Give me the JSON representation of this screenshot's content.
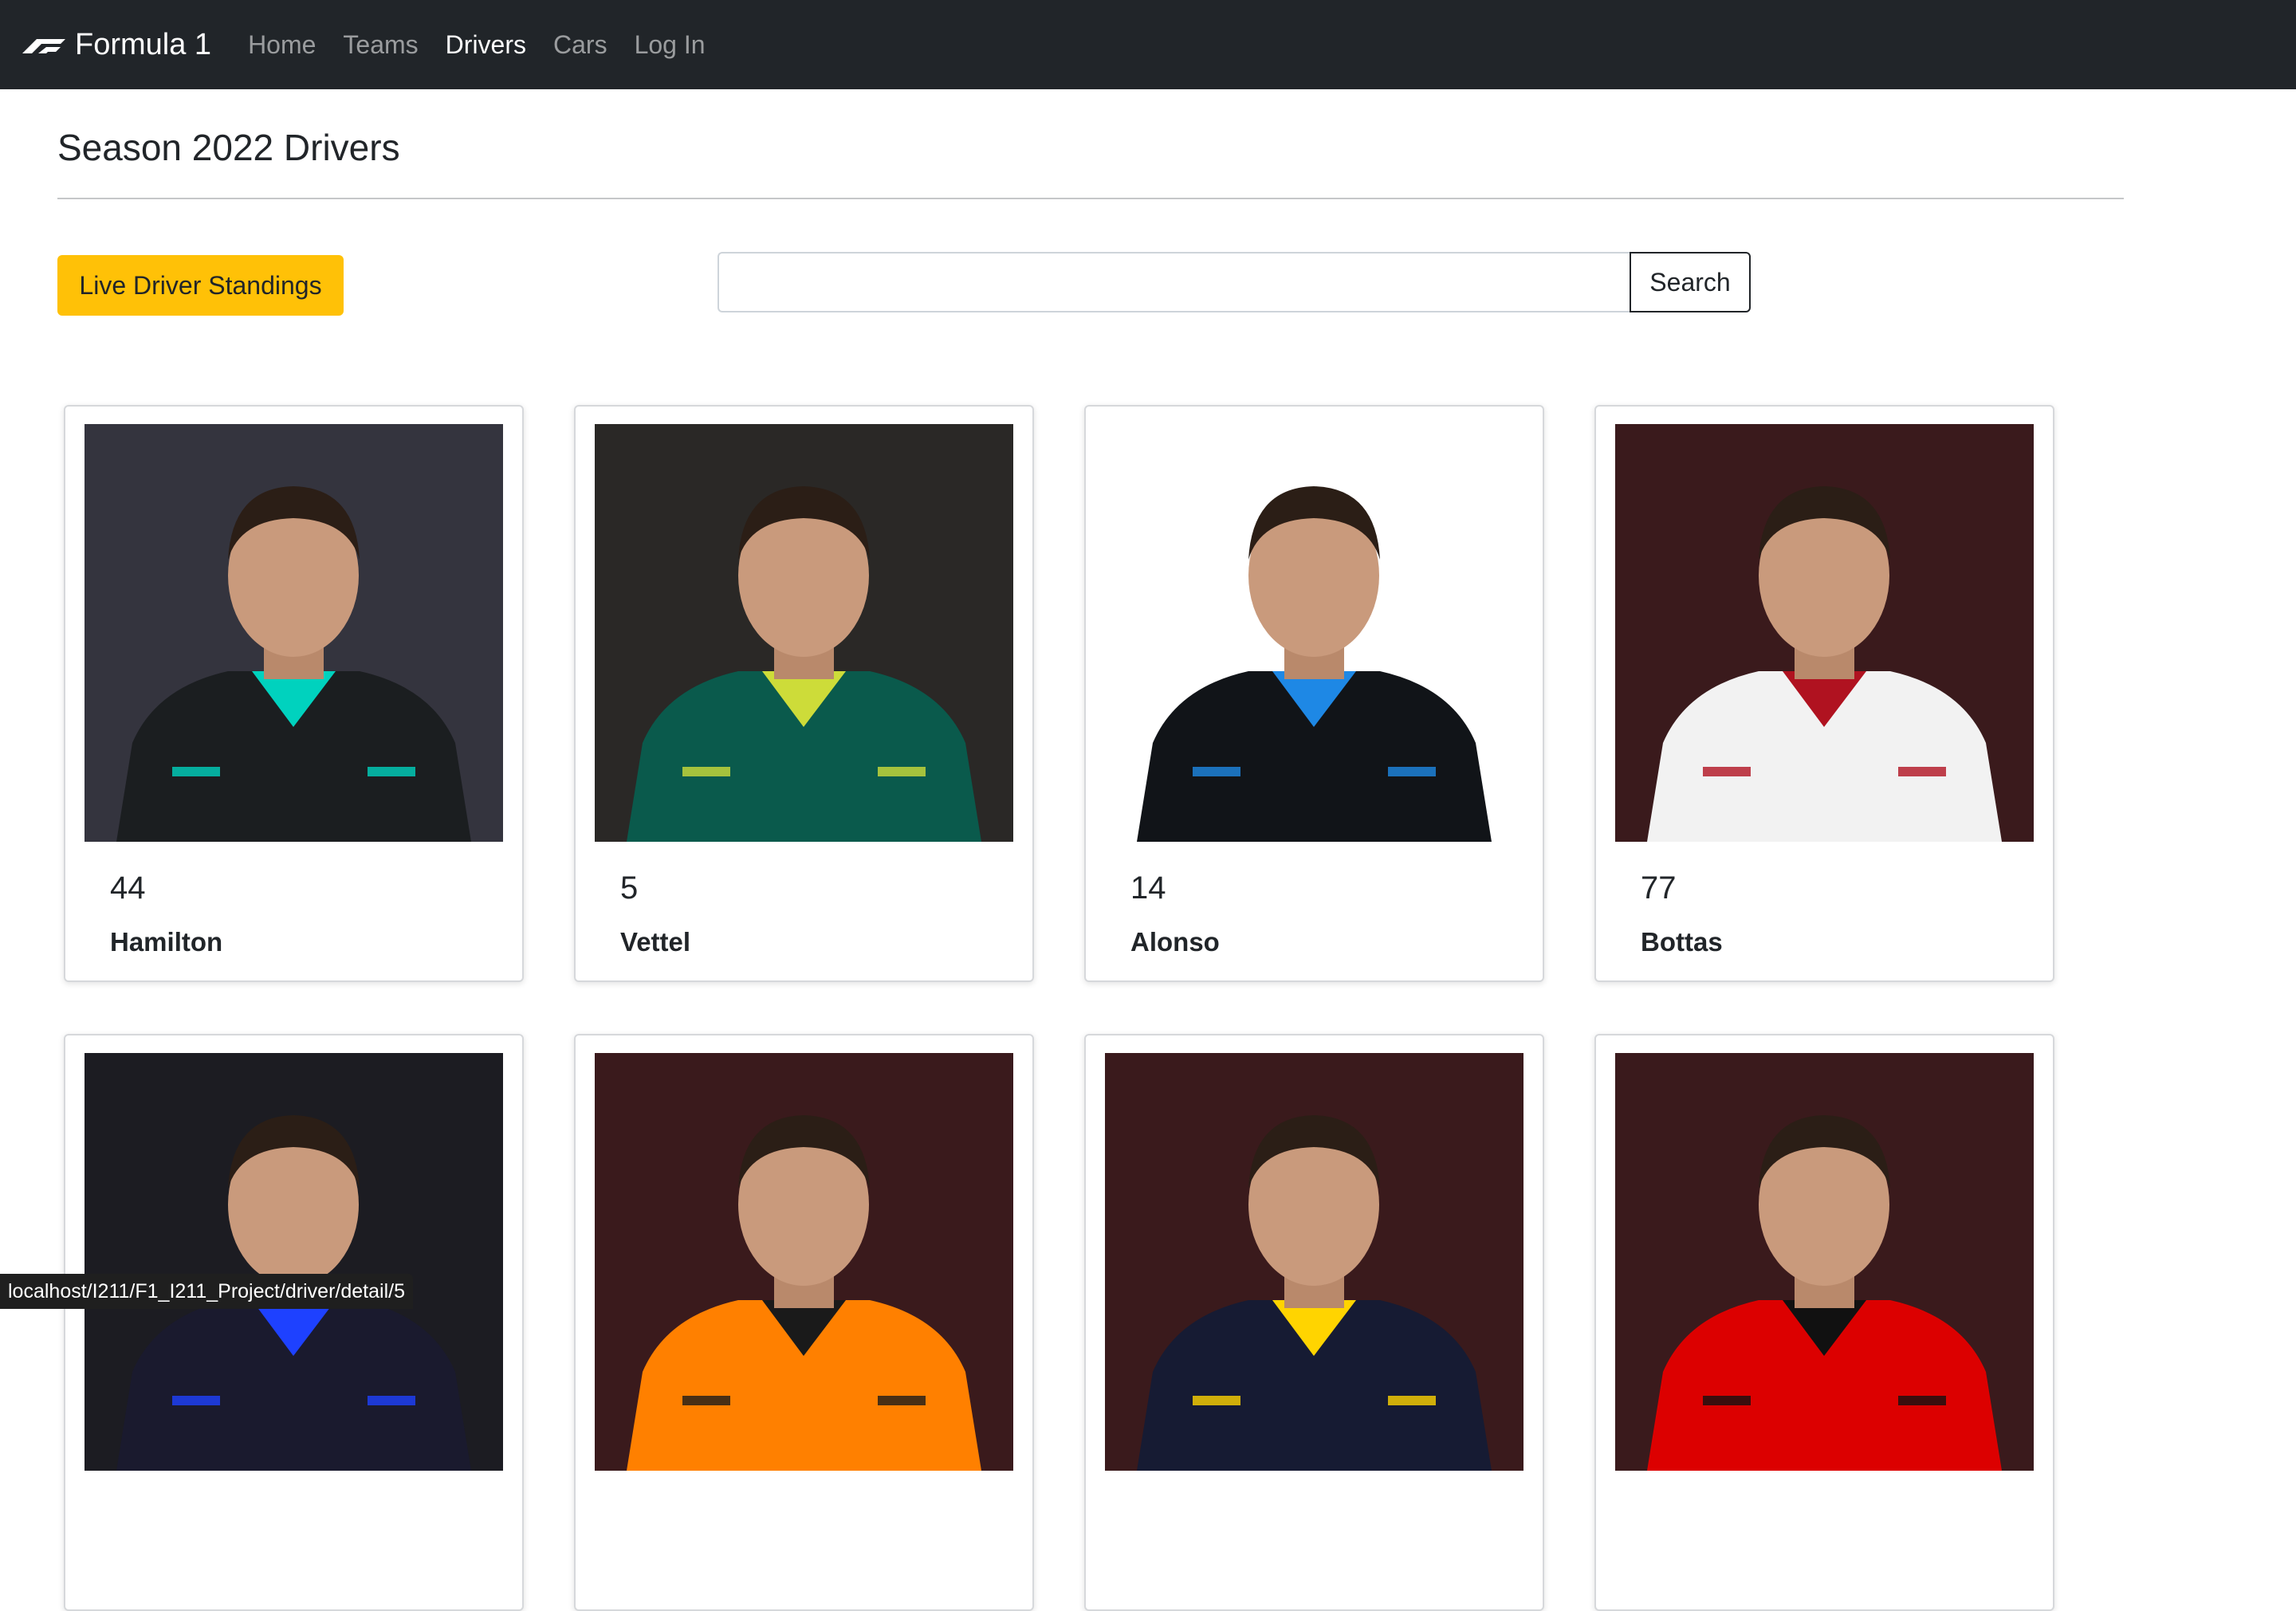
{
  "navbar": {
    "brand": "Formula 1",
    "links": [
      {
        "label": "Home",
        "active": false
      },
      {
        "label": "Teams",
        "active": false
      },
      {
        "label": "Drivers",
        "active": true
      },
      {
        "label": "Cars",
        "active": false
      },
      {
        "label": "Log In",
        "active": false
      }
    ]
  },
  "page": {
    "title": "Season 2022 Drivers"
  },
  "actions": {
    "standings_label": "Live Driver Standings",
    "search_value": "",
    "search_label": "Search"
  },
  "drivers": [
    {
      "number": "44",
      "name": "Hamilton",
      "bg": "#34343e",
      "suit": "#1b1e20",
      "accent": "#00d2be"
    },
    {
      "number": "5",
      "name": "Vettel",
      "bg": "#2a2826",
      "suit": "#0a5a4c",
      "accent": "#cddc39"
    },
    {
      "number": "14",
      "name": "Alonso",
      "bg": "#ffffff",
      "suit": "#111418",
      "accent": "#1e88e5"
    },
    {
      "number": "77",
      "name": "Bottas",
      "bg": "#3a1a1c",
      "suit": "#f2f2f2",
      "accent": "#b01220"
    },
    {
      "number": "",
      "name": "",
      "bg": "#1c1c22",
      "suit": "#1a1a2e",
      "accent": "#1e41ff"
    },
    {
      "number": "",
      "name": "",
      "bg": "#3a1a1c",
      "suit": "#ff8000",
      "accent": "#1a1a1a"
    },
    {
      "number": "",
      "name": "",
      "bg": "#3a1a1c",
      "suit": "#161b33",
      "accent": "#ffd400"
    },
    {
      "number": "",
      "name": "",
      "bg": "#3a1a1c",
      "suit": "#dc0000",
      "accent": "#111111"
    }
  ],
  "status_bar": {
    "url": "localhost/I211/F1_I211_Project/driver/detail/5"
  }
}
